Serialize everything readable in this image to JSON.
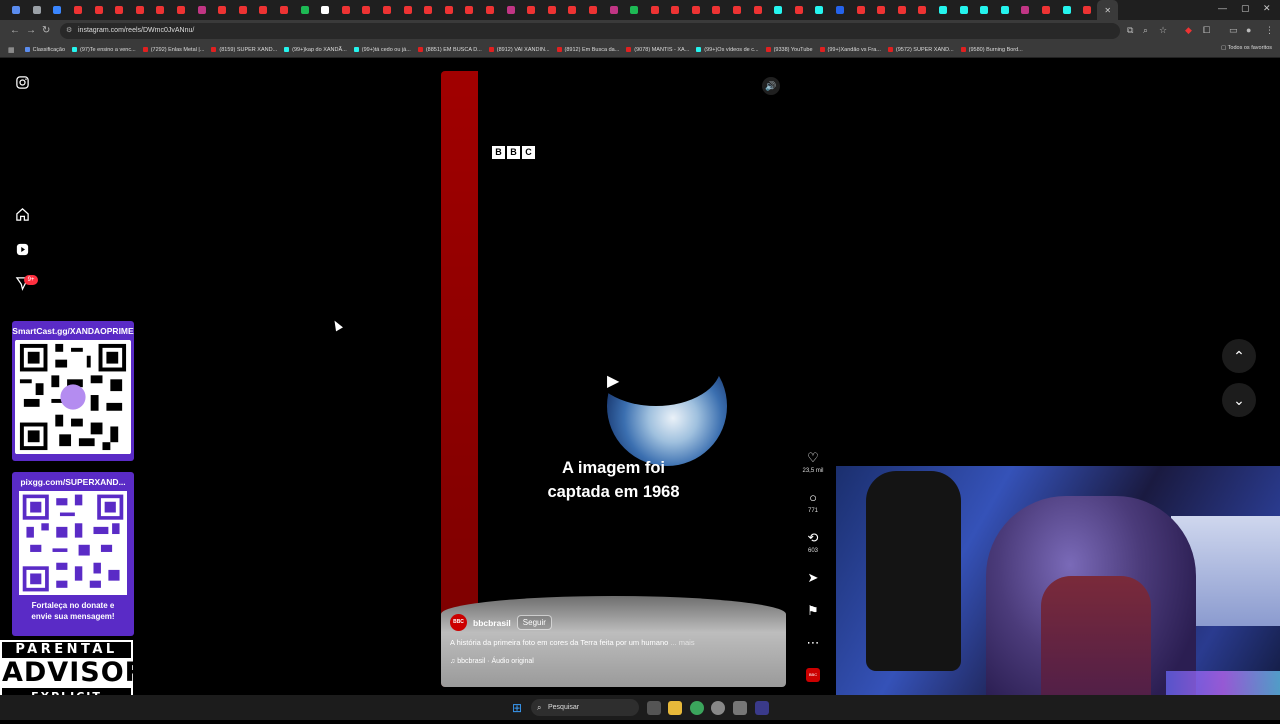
{
  "browser": {
    "url": "instagram.com/reels/DWmc0JvANnu/",
    "bookmarks": [
      "Classificação",
      "(97)Te ensino a venc...",
      "(7292) Enlas Metal |...",
      "(8159) SUPER XAND...",
      "(99+)kap do XANDÃ...",
      "(99+)tá cedo ou já...",
      "(8851) EM BUSCA D...",
      "(8912) VAI XANDIN...",
      "(8912) Em Busca da...",
      "(9078) MANTIS - XA...",
      "(99+)Os vídeos de c...",
      "(9338) YouTube",
      "(99+)Xandão vs Fra...",
      "(9572) SUPER XAND...",
      "(9580) Burning Bord..."
    ],
    "bookmarks_right": "Todos os favoritos"
  },
  "overlay": {
    "qr1_title": "SmartCast.gg/XANDAOPRIME",
    "qr2_title": "pixgg.com/SUPERXAND...",
    "qr2_footer_line1": "Fortaleça no donate e",
    "qr2_footer_line2": "envie sua mensagem!",
    "advisory_top": "PARENTAL",
    "advisory_mid": "ADVISORY",
    "advisory_bot": "EXPLICIT CONTENT"
  },
  "sidebar": {
    "notification_badge": "9+"
  },
  "reel": {
    "bbc_letters": [
      "B",
      "B",
      "C"
    ],
    "caption_line1": "A imagem foi",
    "caption_line2": "captada em 1968",
    "account": "bbcbrasil",
    "follow_label": "Seguir",
    "description": "A história da primeira foto em cores da Terra feita por um humano",
    "more_label": "... mais",
    "audio": "bbcbrasil · Áudio original"
  },
  "actions": {
    "likes": "23,5 mil",
    "comments": "771",
    "reposts": "603"
  },
  "taskbar": {
    "search_placeholder": "Pesquisar"
  },
  "colors": {
    "badge": "#ff3040",
    "overlay_purple": "#5a2bc6",
    "bbc_red": "#a10000"
  }
}
